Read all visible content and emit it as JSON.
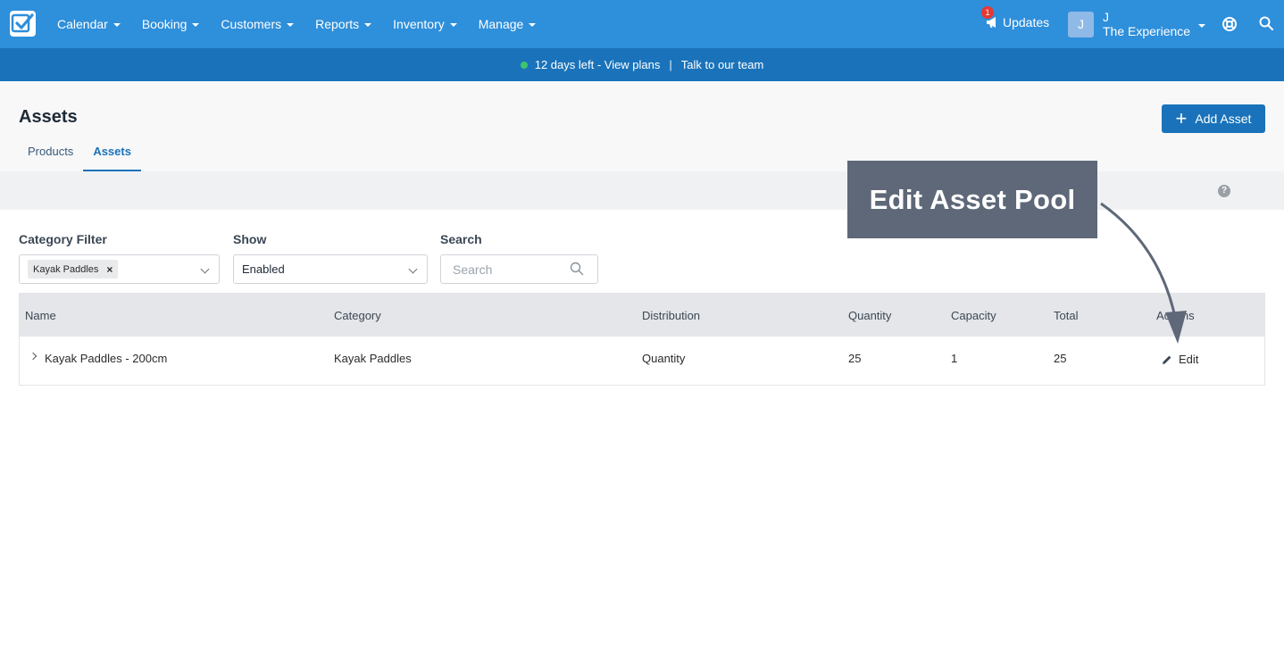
{
  "nav": {
    "items": [
      {
        "label": "Calendar"
      },
      {
        "label": "Booking"
      },
      {
        "label": "Customers"
      },
      {
        "label": "Reports"
      },
      {
        "label": "Inventory"
      },
      {
        "label": "Manage"
      }
    ],
    "updates_label": "Updates",
    "updates_badge": "1",
    "avatar_initial": "J",
    "user_name": "J",
    "user_company": "The Experience",
    "icons": {
      "logo": "checkbox-logo",
      "updates": "megaphone-icon",
      "help": "lifebuoy-icon",
      "search": "search-icon"
    }
  },
  "banner": {
    "trial_text": "12 days left - View plans",
    "separator": "|",
    "talk_text": "Talk to our team",
    "status_color": "#3ec46d"
  },
  "header": {
    "title": "Assets",
    "add_button": "Add Asset",
    "tabs": [
      {
        "label": "Products",
        "active": false
      },
      {
        "label": "Assets",
        "active": true
      }
    ],
    "help_mark": "?"
  },
  "filters": {
    "category_label": "Category Filter",
    "category_chip": "Kayak Paddles",
    "chip_remove": "×",
    "show_label": "Show",
    "show_value": "Enabled",
    "search_label": "Search",
    "search_placeholder": "Search"
  },
  "table": {
    "columns": [
      "Name",
      "Category",
      "Distribution",
      "Quantity",
      "Capacity",
      "Total",
      "Actions"
    ],
    "rows": [
      {
        "name": "Kayak Paddles - 200cm",
        "category": "Kayak Paddles",
        "distribution": "Quantity",
        "quantity": "25",
        "capacity": "1",
        "total": "25",
        "action": "Edit"
      }
    ]
  },
  "annotation": {
    "text": "Edit Asset Pool"
  },
  "colors": {
    "primary": "#2e8fdb",
    "banner": "#1a73ba",
    "button": "#1a73ba",
    "callout": "#5e6878"
  }
}
